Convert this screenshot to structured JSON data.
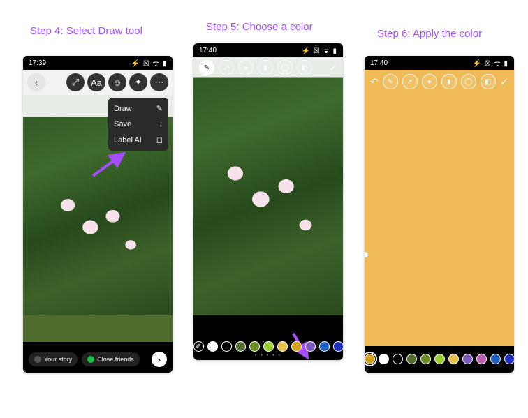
{
  "captions": {
    "step4": "Step 4: Select Draw tool",
    "step5": "Step 5: Choose a color",
    "step6": "Step 6: Apply the color"
  },
  "screen1": {
    "time": "17:39",
    "status": "⚡ ☒ ᯤ ▮",
    "topbar_icons": [
      "back",
      "expand",
      "text",
      "sticker",
      "sparkle",
      "more"
    ],
    "dropdown": {
      "items": [
        {
          "label": "Draw",
          "icon": "✎"
        },
        {
          "label": "Save",
          "icon": "↓"
        },
        {
          "label": "Label AI",
          "icon": "◻"
        }
      ]
    },
    "share": {
      "your_story": "Your story",
      "close_friends": "Close friends"
    }
  },
  "screen2": {
    "time": "17:40",
    "status": "⚡ ☒ ᯤ ▮",
    "tools": [
      "pen",
      "arrow",
      "glow",
      "chisel",
      "outline",
      "eraser"
    ],
    "palette": [
      "#ffffff",
      "#000000",
      "#556b2f",
      "#6b8e23",
      "#9acd32",
      "#e6c14a",
      "#d4a017",
      "#7b5bbe",
      "#1e5fbf",
      "#1e2ebf"
    ],
    "pager": "• • • • •"
  },
  "screen3": {
    "time": "17:40",
    "status": "⚡ ☒ ᯤ ▮",
    "canvas_color": "#f0bb56",
    "tools": [
      "undo",
      "pen",
      "arrow",
      "glow",
      "chisel",
      "outline",
      "eraser",
      "done"
    ],
    "palette": [
      "#d4a017",
      "#ffffff",
      "#000000",
      "#556b2f",
      "#6b8e23",
      "#9acd32",
      "#e6c14a",
      "#7b5bbe",
      "#bf5bb0",
      "#1e5fbf",
      "#1e2ebf"
    ],
    "selected_swatch_index": 0
  }
}
